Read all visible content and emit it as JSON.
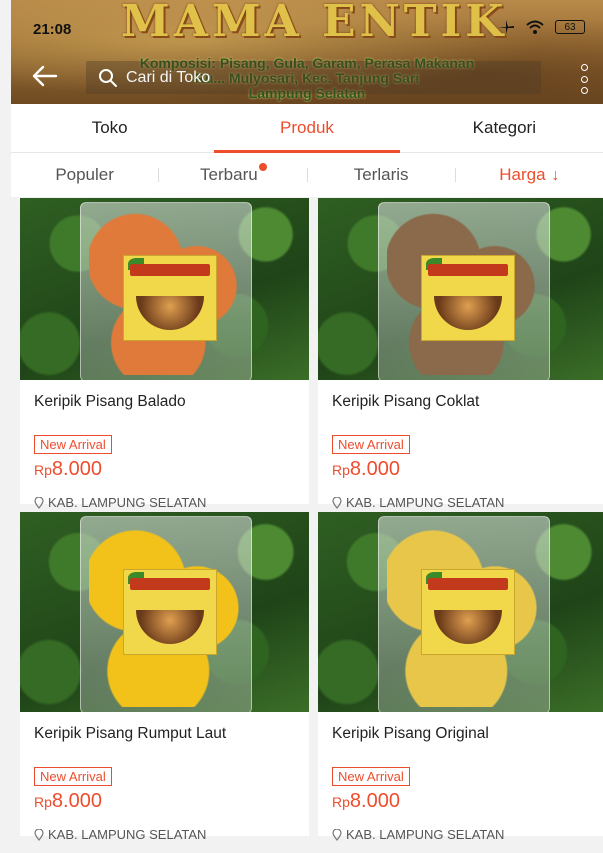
{
  "status": {
    "time": "21:08",
    "battery": "63"
  },
  "banner": {
    "brand": "MAMA ENTIK",
    "composition": "Komposisi: Pisang, Gula, Garam, Perasa Makanan",
    "address": "Ru... Mulyosari, Kec. Tanjung Sari",
    "region": "Lampung Selatan"
  },
  "search": {
    "placeholder": "Cari di Toko"
  },
  "tabs": [
    {
      "label": "Toko"
    },
    {
      "label": "Produk",
      "active": true
    },
    {
      "label": "Kategori"
    }
  ],
  "sort": [
    {
      "label": "Populer"
    },
    {
      "label": "Terbaru",
      "dot": true
    },
    {
      "label": "Terlaris"
    },
    {
      "label": "Harga",
      "active": true,
      "icon": "arrow-down-icon"
    }
  ],
  "products": [
    {
      "title": "Keripik Pisang Balado",
      "badge": "New Arrival",
      "currency": "Rp",
      "price": "8.000",
      "location": "KAB. LAMPUNG SELATAN",
      "chip_color": "#e07a3a"
    },
    {
      "title": "Keripik Pisang Coklat",
      "badge": "New Arrival",
      "currency": "Rp",
      "price": "8.000",
      "location": "KAB. LAMPUNG SELATAN",
      "chip_color": "#8a6a4a"
    },
    {
      "title": "Keripik Pisang Rumput Laut",
      "badge": "New Arrival",
      "currency": "Rp",
      "price": "8.000",
      "location": "KAB. LAMPUNG SELATAN",
      "chip_color": "#f2c21a"
    },
    {
      "title": "Keripik Pisang Original",
      "badge": "New Arrival",
      "currency": "Rp",
      "price": "8.000",
      "location": "KAB. LAMPUNG SELATAN",
      "chip_color": "#e8c64a"
    }
  ],
  "colors": {
    "accent": "#ee4d2d"
  }
}
